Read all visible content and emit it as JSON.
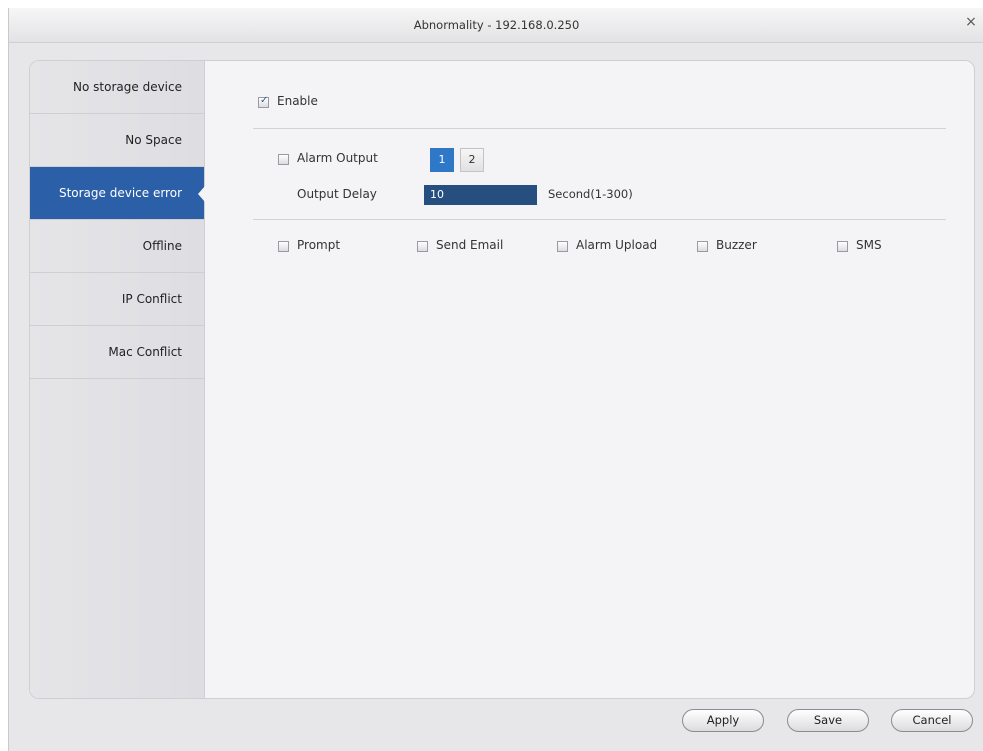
{
  "window": {
    "title": "Abnormality - 192.168.0.250",
    "close_label": "×"
  },
  "sidebar": {
    "items": [
      {
        "label": "No storage device",
        "active": false
      },
      {
        "label": "No Space",
        "active": false
      },
      {
        "label": "Storage device error",
        "active": true
      },
      {
        "label": "Offline",
        "active": false
      },
      {
        "label": "IP Conflict",
        "active": false
      },
      {
        "label": "Mac Conflict",
        "active": false
      }
    ]
  },
  "form": {
    "enable": {
      "label": "Enable",
      "checked": true
    },
    "alarm_output": {
      "label": "Alarm Output",
      "checked": false
    },
    "channels": [
      {
        "label": "1",
        "selected": true
      },
      {
        "label": "2",
        "selected": false
      }
    ],
    "output_delay": {
      "label": "Output Delay",
      "value": "10",
      "unit": "Second(1-300)"
    },
    "actions": [
      {
        "label": "Prompt",
        "checked": false
      },
      {
        "label": "Send Email",
        "checked": false
      },
      {
        "label": "Alarm Upload",
        "checked": false
      },
      {
        "label": "Buzzer",
        "checked": false
      },
      {
        "label": "SMS",
        "checked": false
      }
    ]
  },
  "buttons": {
    "apply": "Apply",
    "save": "Save",
    "cancel": "Cancel"
  },
  "colors": {
    "active_item": "#2b5fa7",
    "selected_channel": "#2f78c8",
    "input_bg": "#264f80"
  }
}
